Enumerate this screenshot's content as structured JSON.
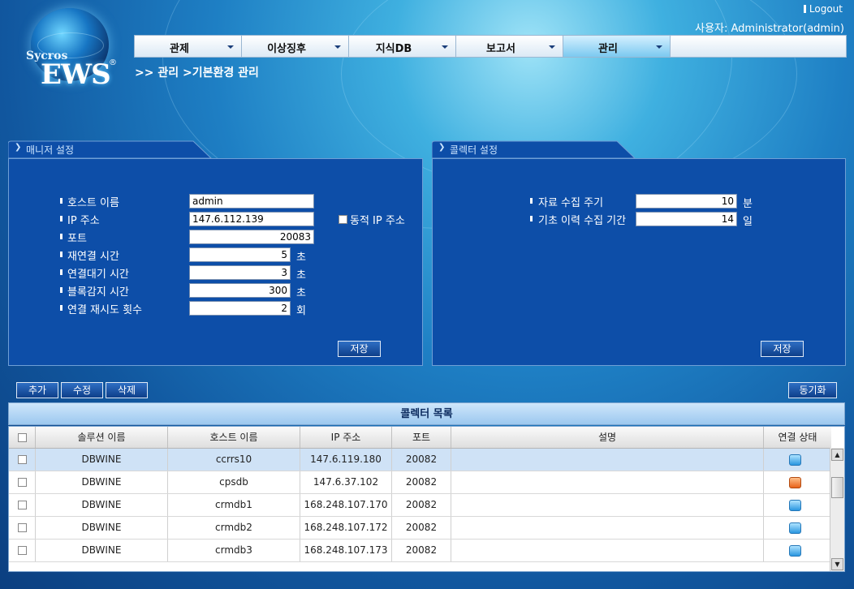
{
  "header": {
    "logout": "Logout",
    "user_label": "사용자: Administrator(admin)",
    "logo_sub": "Sycros",
    "logo_main": "EWS",
    "logo_reg": "®"
  },
  "menu": [
    {
      "label": "관제"
    },
    {
      "label": "이상징후"
    },
    {
      "label": "지식DB"
    },
    {
      "label": "보고서"
    },
    {
      "label": "관리",
      "active": true
    }
  ],
  "breadcrumb": ">> 관리 >기본환경 관리",
  "manager": {
    "tab_label": "매니저 설정",
    "host_label": "호스트 이름",
    "host_value": "admin",
    "ip_label": "IP 주소",
    "ip_value": "147.6.112.139",
    "dynamic_ip_label": "동적 IP 주소",
    "port_label": "포트",
    "port_value": "20083",
    "reconnect_label": "재연결 시간",
    "reconnect_value": "5",
    "reconnect_unit": "초",
    "wait_label": "연결대기 시간",
    "wait_value": "3",
    "wait_unit": "초",
    "block_label": "블록감지 시간",
    "block_value": "300",
    "block_unit": "초",
    "retry_label": "연결 재시도 횟수",
    "retry_value": "2",
    "retry_unit": "회",
    "save_label": "저장"
  },
  "collector": {
    "tab_label": "콜렉터 설정",
    "interval_label": "자료 수집 주기",
    "interval_value": "10",
    "interval_unit": "분",
    "history_label": "기초 이력 수집 기간",
    "history_value": "14",
    "history_unit": "일",
    "save_label": "저장"
  },
  "actions": {
    "add": "추가",
    "edit": "수정",
    "delete": "삭제",
    "sync": "동기화"
  },
  "collector_list": {
    "title": "콜렉터 목록",
    "columns": [
      "솔루션 이름",
      "호스트 이름",
      "IP 주소",
      "포트",
      "설명",
      "연결 상태"
    ],
    "rows": [
      {
        "solution": "DBWINE",
        "host": "ccrrs10",
        "ip": "147.6.119.180",
        "port": "20082",
        "desc": "",
        "status": "ok"
      },
      {
        "solution": "DBWINE",
        "host": "cpsdb",
        "ip": "147.6.37.102",
        "port": "20082",
        "desc": "",
        "status": "err"
      },
      {
        "solution": "DBWINE",
        "host": "crmdb1",
        "ip": "168.248.107.170",
        "port": "20082",
        "desc": "",
        "status": "ok"
      },
      {
        "solution": "DBWINE",
        "host": "crmdb2",
        "ip": "168.248.107.172",
        "port": "20082",
        "desc": "",
        "status": "ok"
      },
      {
        "solution": "DBWINE",
        "host": "crmdb3",
        "ip": "168.248.107.173",
        "port": "20082",
        "desc": "",
        "status": "ok"
      }
    ]
  },
  "colors": {
    "panel": "#0d4ea8",
    "status_ok": "#2a97e0",
    "status_err": "#e8621a"
  }
}
